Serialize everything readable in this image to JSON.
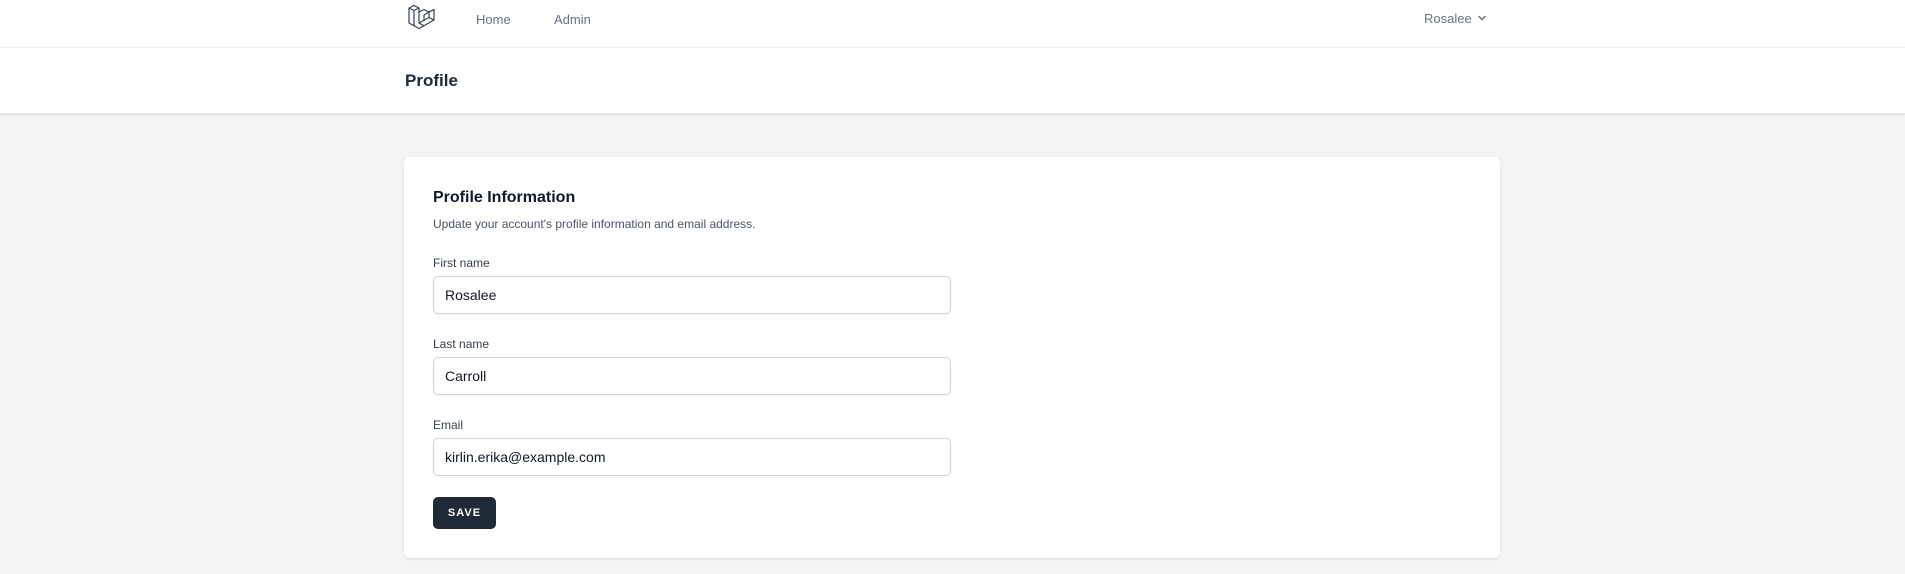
{
  "nav": {
    "logo_icon": "laravel-logo-icon",
    "links": [
      {
        "label": "Home"
      },
      {
        "label": "Admin"
      }
    ],
    "user": {
      "name": "Rosalee",
      "icon": "chevron-down-icon"
    }
  },
  "header": {
    "title": "Profile"
  },
  "profile_form": {
    "title": "Profile Information",
    "description": "Update your account's profile information and email address.",
    "fields": [
      {
        "label": "First name",
        "value": "Rosalee"
      },
      {
        "label": "Last name",
        "value": "Carroll"
      },
      {
        "label": "Email",
        "value": "kirlin.erika@example.com"
      }
    ],
    "save_label": "SAVE"
  },
  "colors": {
    "page_bg": "#f3f4f6",
    "surface": "#ffffff",
    "button_bg": "#1f2937",
    "muted_text": "#6b7280",
    "input_border": "#d1d5db"
  }
}
